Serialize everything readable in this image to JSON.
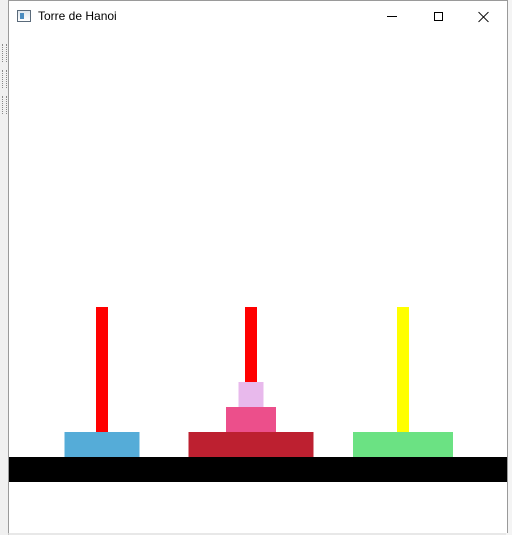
{
  "window": {
    "title": "Torre de Hanoi",
    "controls": [
      "minimize",
      "maximize",
      "close"
    ]
  },
  "game": {
    "base_color": "#000000",
    "pegs": [
      {
        "pole_color": "#ff0000",
        "disks": [
          {
            "color": "#55acd8"
          }
        ]
      },
      {
        "pole_color": "#ff0000",
        "disks": [
          {
            "color": "#bd2030"
          },
          {
            "color": "#ec4f8b"
          },
          {
            "color": "#e8b9ec"
          }
        ]
      },
      {
        "pole_color": "#ffff00",
        "disks": [
          {
            "color": "#6be283"
          }
        ]
      }
    ]
  }
}
